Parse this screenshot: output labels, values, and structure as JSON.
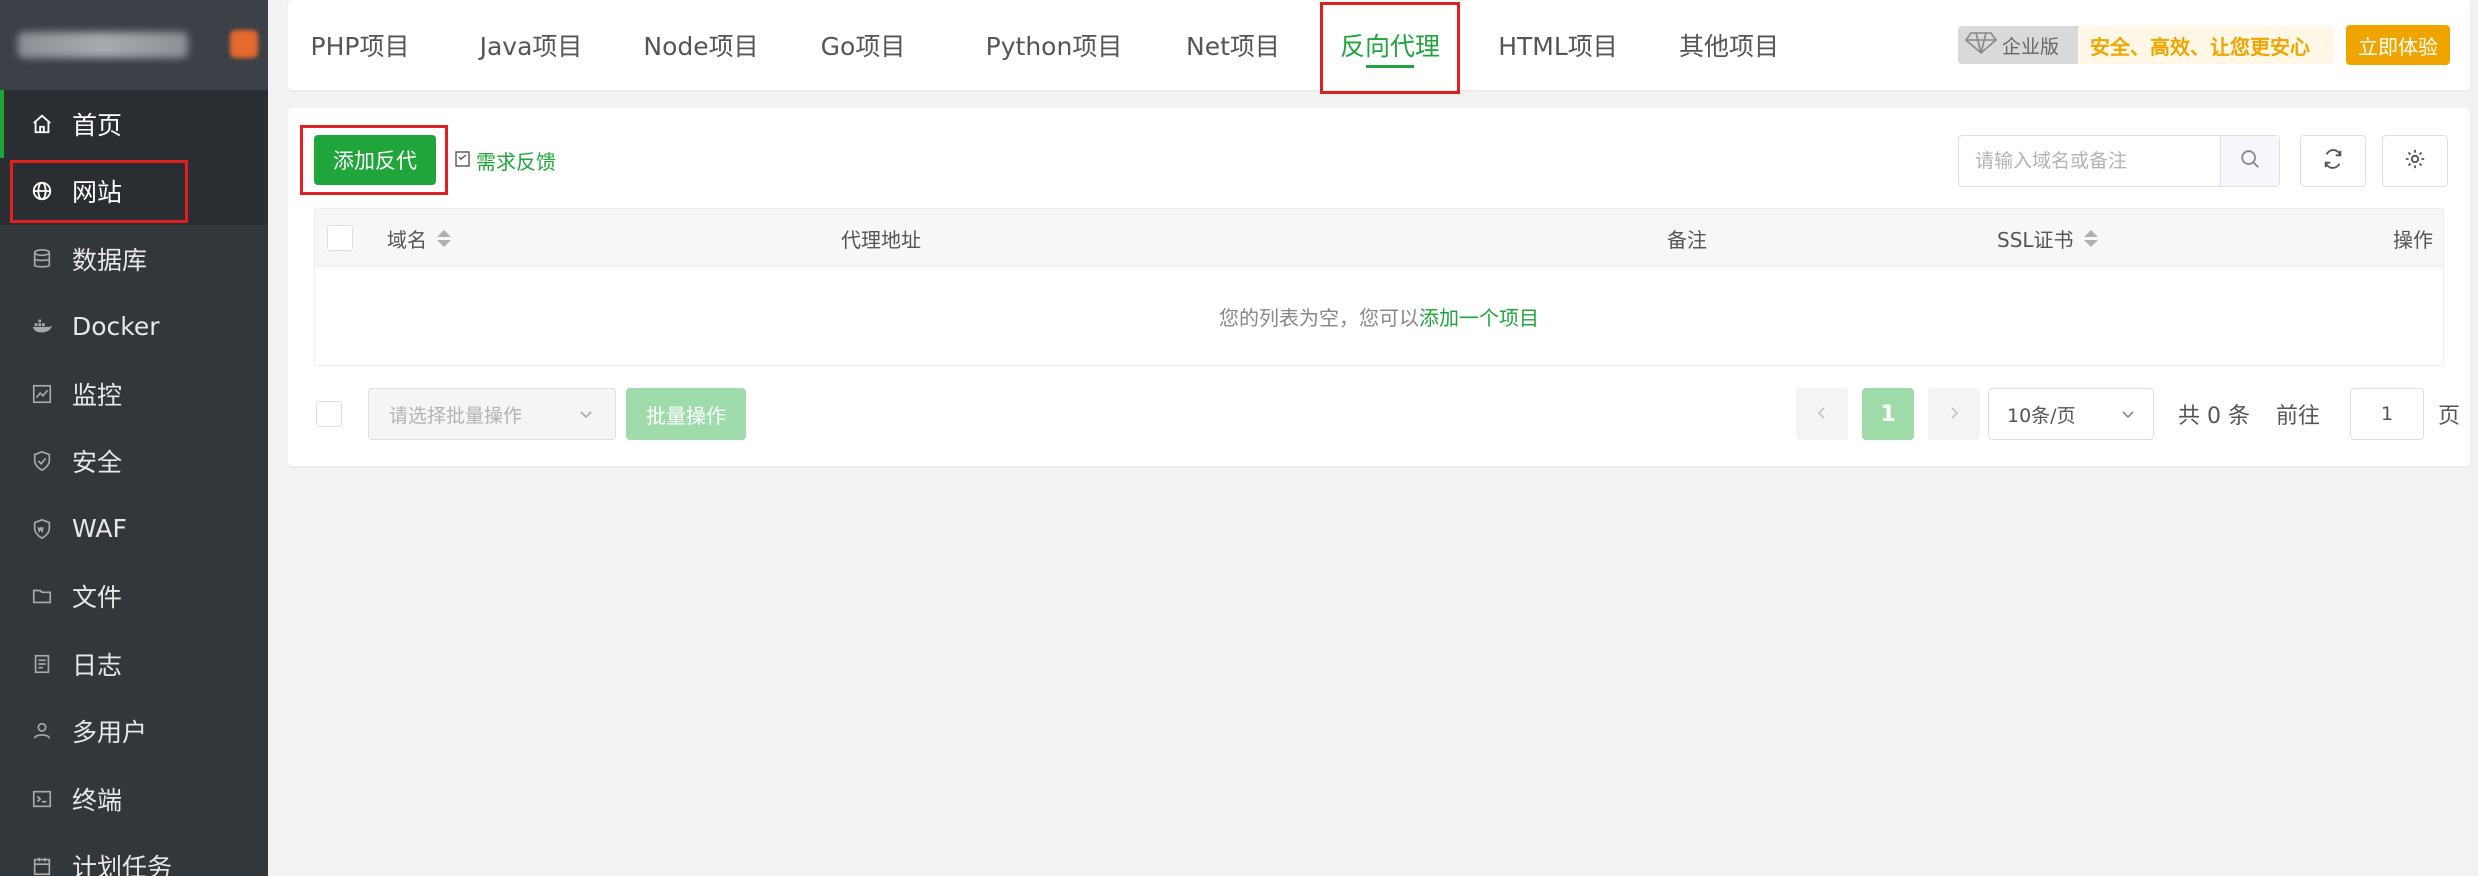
{
  "sidebar": {
    "items": [
      {
        "label": "首页",
        "icon": "home-icon"
      },
      {
        "label": "网站",
        "icon": "globe-icon"
      },
      {
        "label": "数据库",
        "icon": "database-icon"
      },
      {
        "label": "Docker",
        "icon": "docker-icon"
      },
      {
        "label": "监控",
        "icon": "monitor-icon"
      },
      {
        "label": "安全",
        "icon": "shield-icon"
      },
      {
        "label": "WAF",
        "icon": "waf-shield-icon"
      },
      {
        "label": "文件",
        "icon": "folder-icon"
      },
      {
        "label": "日志",
        "icon": "log-icon"
      },
      {
        "label": "多用户",
        "icon": "users-icon"
      },
      {
        "label": "终端",
        "icon": "terminal-icon"
      },
      {
        "label": "计划任务",
        "icon": "calendar-icon"
      }
    ]
  },
  "tabs": [
    {
      "label": "PHP项目"
    },
    {
      "label": "Java项目"
    },
    {
      "label": "Node项目"
    },
    {
      "label": "Go项目"
    },
    {
      "label": "Python项目"
    },
    {
      "label": "Net项目"
    },
    {
      "label": "反向代理"
    },
    {
      "label": "HTML项目"
    },
    {
      "label": "其他项目"
    }
  ],
  "enterprise": {
    "badge": "企业版",
    "slogan": "安全、高效、让您更安心",
    "try_label": "立即体验"
  },
  "toolbar": {
    "add_label": "添加反代",
    "feedback_label": "需求反馈",
    "search_placeholder": "请输入域名或备注"
  },
  "table": {
    "columns": {
      "domain": "域名",
      "proxy": "代理地址",
      "remark": "备注",
      "ssl": "SSL证书",
      "ops": "操作"
    },
    "empty_text": "您的列表为空，您可以",
    "empty_link": "添加一个项目"
  },
  "footer": {
    "batch_placeholder": "请选择批量操作",
    "batch_button": "批量操作",
    "current_page": "1",
    "page_size": "10条/页",
    "total_text": "共 0 条",
    "goto_label": "前往",
    "goto_value": "1",
    "page_suffix": "页"
  },
  "colors": {
    "accent": "#20a53a",
    "sidebar_bg": "#32373c",
    "enterprise": "#f0a400",
    "highlight": "#e02020"
  }
}
